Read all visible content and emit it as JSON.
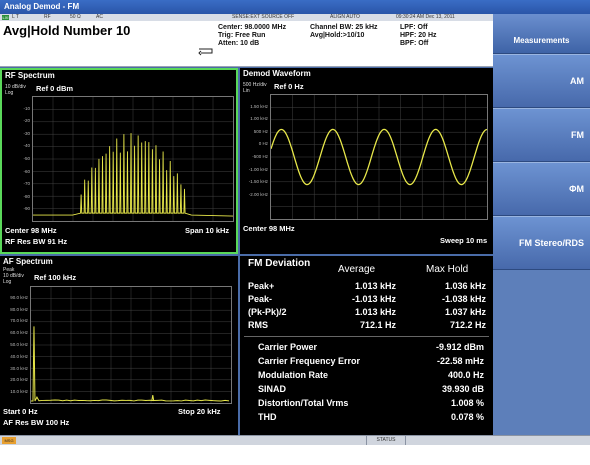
{
  "window": {
    "title": "Analog Demod - FM"
  },
  "topbar": {
    "lxi": "LXI",
    "t": "L T",
    "rf": "RF",
    "ohm": "50 Ω",
    "ac": "AC",
    "sense": "SENSE:EXT SOURCE OFF",
    "align": "ALIGN AUTO",
    "datetime": "09:30:24 AM Dec 13, 2011"
  },
  "header": {
    "title": "Avg|Hold Number 10",
    "col1": [
      "Center: 98.0000 MHz",
      "Trig: Free Run",
      "Atten: 10 dB"
    ],
    "col2": [
      "Channel BW: 25 kHz",
      "Avg|Hold:>10/10"
    ],
    "col3": [
      "LPF: Off",
      "HPF: 20 Hz",
      "BPF: Off"
    ]
  },
  "rf_spectrum": {
    "title": "RF Spectrum",
    "scale": [
      "10 dB/div",
      "Log"
    ],
    "ref": "Ref 0 dBm",
    "yticks": [
      "-10",
      "-20",
      "-30",
      "-40",
      "-50",
      "-60",
      "-70",
      "-80",
      "-90"
    ],
    "center": "Center 98 MHz",
    "span": "Span 10 kHz",
    "resbw": "RF Res BW 91 Hz"
  },
  "demod": {
    "title": "Demod Waveform",
    "scale": [
      "500 Hz/div",
      "Lin"
    ],
    "ref": "Ref 0 Hz",
    "yticks": [
      "1.50 kHz",
      "1.00 kHz",
      "500 Hz",
      "0 Hz",
      "-500 Hz",
      "-1.00 kHz",
      "-1.50 kHz",
      "-2.00 kHz"
    ],
    "center": "Center 98 MHz",
    "sweep": "Sweep 10 ms"
  },
  "af_spectrum": {
    "title": "AF Spectrum",
    "scale": [
      "Peak",
      "10 dB/div",
      "Log"
    ],
    "ref": "Ref 100 kHz",
    "yticks": [
      "90.0 kHz",
      "80.0 kHz",
      "70.0 kHz",
      "60.0 kHz",
      "50.0 kHz",
      "40.0 kHz",
      "30.0 kHz",
      "20.0 kHz",
      "10.0 kHz"
    ],
    "start": "Start 0 Hz",
    "stop": "Stop 20 kHz",
    "resbw": "AF Res BW 100 Hz"
  },
  "fm_deviation": {
    "title": "FM Deviation",
    "col_avg": "Average",
    "col_max": "Max Hold",
    "rows": [
      {
        "label": "Peak+",
        "avg": "1.013 kHz",
        "max": "1.036 kHz"
      },
      {
        "label": "Peak-",
        "avg": "-1.013 kHz",
        "max": "-1.038 kHz"
      },
      {
        "label": "(Pk-Pk)/2",
        "avg": "1.013 kHz",
        "max": "1.037 kHz"
      },
      {
        "label": "RMS",
        "avg": "712.1 Hz",
        "max": "712.2 Hz"
      }
    ],
    "metrics": [
      {
        "label": "Carrier Power",
        "value": "-9.912 dBm"
      },
      {
        "label": "Carrier Frequency Error",
        "value": "-22.58 mHz"
      },
      {
        "label": "Modulation Rate",
        "value": "400.0 Hz"
      },
      {
        "label": "SINAD",
        "value": "39.930 dB"
      },
      {
        "label": "Distortion/Total Vrms",
        "value": "1.008 %"
      },
      {
        "label": "THD",
        "value": "0.078 %"
      }
    ]
  },
  "softkeys": {
    "title": "Measurements",
    "keys": [
      "AM",
      "FM",
      "ΦM",
      "FM Stereo/RDS"
    ]
  },
  "statusbar": {
    "msg": "MSG",
    "status": "STATUS"
  },
  "colors": {
    "trace": "#e8e84a",
    "highlight": "#5ad85a",
    "softkey": "#5a7fbd"
  }
}
